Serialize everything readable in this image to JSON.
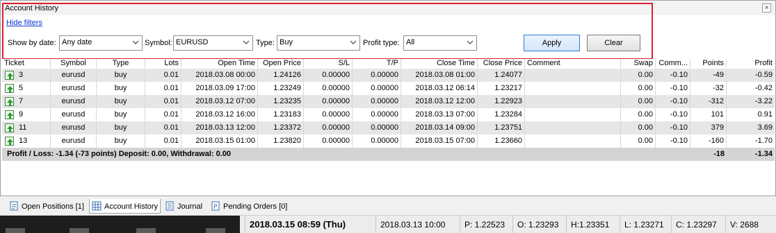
{
  "window": {
    "title": "Account History",
    "close_glyph": "×"
  },
  "filters": {
    "hide_filters": "Hide filters",
    "show_by_date_label": "Show by date:",
    "show_by_date_value": "Any date",
    "symbol_label": "Symbol:",
    "symbol_value": "EURUSD",
    "type_label": "Type:",
    "type_value": "Buy",
    "profit_type_label": "Profit type:",
    "profit_type_value": "All",
    "apply": "Apply",
    "clear": "Clear"
  },
  "table": {
    "columns": [
      "Ticket",
      "Symbol",
      "Type",
      "Lots",
      "Open Time",
      "Open Price",
      "S/L",
      "T/P",
      "Close Time",
      "Close Price",
      "Comment",
      "Swap",
      "Comm...",
      "Points",
      "Profit"
    ],
    "rows": [
      {
        "ticket": "3",
        "symbol": "eurusd",
        "type": "buy",
        "lots": "0.01",
        "open_time": "2018.03.08 00:00",
        "open_price": "1.24126",
        "sl": "0.00000",
        "tp": "0.00000",
        "close_time": "2018.03.08 01:00",
        "close_price": "1.24077",
        "comment": "",
        "swap": "0.00",
        "commission": "-0.10",
        "points": "-49",
        "profit": "-0.59"
      },
      {
        "ticket": "5",
        "symbol": "eurusd",
        "type": "buy",
        "lots": "0.01",
        "open_time": "2018.03.09 17:00",
        "open_price": "1.23249",
        "sl": "0.00000",
        "tp": "0.00000",
        "close_time": "2018.03.12 06:14",
        "close_price": "1.23217",
        "comment": "",
        "swap": "0.00",
        "commission": "-0.10",
        "points": "-32",
        "profit": "-0.42"
      },
      {
        "ticket": "7",
        "symbol": "eurusd",
        "type": "buy",
        "lots": "0.01",
        "open_time": "2018.03.12 07:00",
        "open_price": "1.23235",
        "sl": "0.00000",
        "tp": "0.00000",
        "close_time": "2018.03.12 12:00",
        "close_price": "1.22923",
        "comment": "",
        "swap": "0.00",
        "commission": "-0.10",
        "points": "-312",
        "profit": "-3.22"
      },
      {
        "ticket": "9",
        "symbol": "eurusd",
        "type": "buy",
        "lots": "0.01",
        "open_time": "2018.03.12 16:00",
        "open_price": "1.23183",
        "sl": "0.00000",
        "tp": "0.00000",
        "close_time": "2018.03.13 07:00",
        "close_price": "1.23284",
        "comment": "",
        "swap": "0.00",
        "commission": "-0.10",
        "points": "101",
        "profit": "0.91"
      },
      {
        "ticket": "11",
        "symbol": "eurusd",
        "type": "buy",
        "lots": "0.01",
        "open_time": "2018.03.13 12:00",
        "open_price": "1.23372",
        "sl": "0.00000",
        "tp": "0.00000",
        "close_time": "2018.03.14 09:00",
        "close_price": "1.23751",
        "comment": "",
        "swap": "0.00",
        "commission": "-0.10",
        "points": "379",
        "profit": "3.69"
      },
      {
        "ticket": "13",
        "symbol": "eurusd",
        "type": "buy",
        "lots": "0.01",
        "open_time": "2018.03.15 01:00",
        "open_price": "1.23820",
        "sl": "0.00000",
        "tp": "0.00000",
        "close_time": "2018.03.15 07:00",
        "close_price": "1.23660",
        "comment": "",
        "swap": "0.00",
        "commission": "-0.10",
        "points": "-160",
        "profit": "-1.70"
      }
    ],
    "summary": {
      "text": "Profit / Loss: -1.34 (-73 points) Deposit: 0.00, Withdrawal: 0.00",
      "points": "-18",
      "profit": "-1.34"
    }
  },
  "tabs": [
    {
      "label": "Open Positions [1]",
      "icon": "document-icon",
      "active": false
    },
    {
      "label": "Account History",
      "icon": "table-icon",
      "active": true
    },
    {
      "label": "Journal",
      "icon": "journal-icon",
      "active": false
    },
    {
      "label": "Pending Orders [0]",
      "icon": "pending-orders-icon",
      "active": false
    }
  ],
  "statusbar": {
    "current_time": "2018.03.15 08:59 (Thu)",
    "bar_time": "2018.03.13 10:00",
    "p": "P: 1.22523",
    "o": "O: 1.23293",
    "h": "H:1.23351",
    "l": "L: 1.23271",
    "c": "C: 1.23297",
    "v": "V: 2688"
  },
  "colors": {
    "highlight_border": "#d9212b",
    "link": "#0a35d6",
    "row_alt": "#e6e6e6",
    "summary_bg": "#d4d4d4"
  }
}
